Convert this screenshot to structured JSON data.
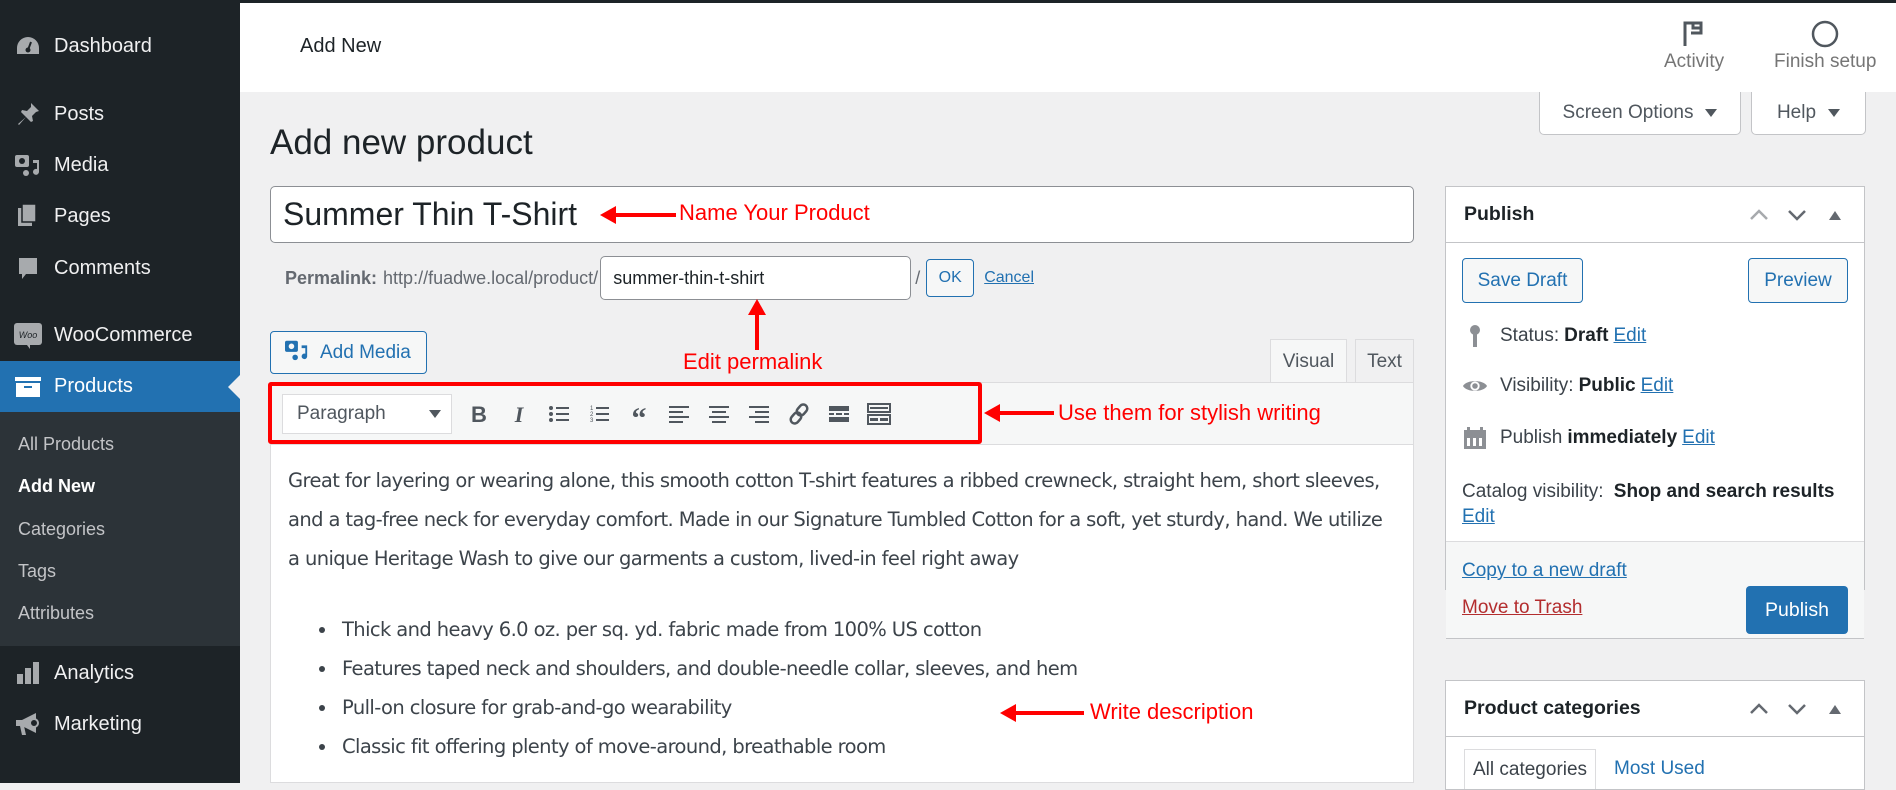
{
  "sidebar": {
    "items": [
      {
        "label": "Dashboard",
        "icon": "dashboard-icon"
      },
      {
        "label": "Posts",
        "icon": "pin-icon"
      },
      {
        "label": "Media",
        "icon": "media-icon"
      },
      {
        "label": "Pages",
        "icon": "pages-icon"
      },
      {
        "label": "Comments",
        "icon": "comment-icon"
      },
      {
        "label": "WooCommerce",
        "icon": "woo-icon"
      },
      {
        "label": "Products",
        "icon": "archive-box-icon",
        "active": true
      },
      {
        "label": "Analytics",
        "icon": "bar-chart-icon"
      },
      {
        "label": "Marketing",
        "icon": "megaphone-icon"
      }
    ],
    "submenu": [
      {
        "label": "All Products"
      },
      {
        "label": "Add New",
        "current": true
      },
      {
        "label": "Categories"
      },
      {
        "label": "Tags"
      },
      {
        "label": "Attributes"
      }
    ]
  },
  "header": {
    "title": "Add New",
    "activity_label": "Activity",
    "finish_setup_label": "Finish setup"
  },
  "screen_options_label": "Screen Options",
  "help_label": "Help",
  "page_title": "Add new product",
  "product": {
    "title": "Summer Thin T-Shirt",
    "permalink_label": "Permalink:",
    "permalink_base": "http://fuadwe.local/product/",
    "slug": "summer-thin-t-shirt",
    "slug_suffix": "/",
    "ok_label": "OK",
    "cancel_label": "Cancel"
  },
  "editor": {
    "add_media_label": "Add Media",
    "tabs": [
      {
        "label": "Visual",
        "active": true
      },
      {
        "label": "Text"
      }
    ],
    "format_select": "Paragraph",
    "toolbar": [
      "bold",
      "italic",
      "bullet-list",
      "numbered-list",
      "blockquote",
      "align-left",
      "align-center",
      "align-right",
      "link",
      "read-more",
      "toolbar-toggle"
    ],
    "paragraph": "Great for layering or wearing alone, this smooth cotton T-shirt features a ribbed crewneck, straight hem, short sleeves, and a tag-free neck for everyday comfort. Made in our Signature Tumbled Cotton for a soft, yet sturdy, hand. We utilize a unique Heritage Wash to give our garments a custom, lived-in feel right away",
    "bullets": [
      "Thick and heavy 6.0 oz. per sq. yd. fabric made from 100% US cotton",
      "Features taped neck and shoulders, and double-needle collar, sleeves, and hem",
      "Pull-on closure for grab-and-go wearability",
      "Classic fit offering plenty of move-around, breathable room"
    ]
  },
  "annotations": {
    "name_product": "Name Your Product",
    "edit_permalink": "Edit permalink",
    "toolbar_hint": "Use them for stylish writing",
    "write_description": "Write description",
    "color": "#ff0000"
  },
  "publish": {
    "title": "Publish",
    "save_draft_label": "Save Draft",
    "preview_label": "Preview",
    "status_label": "Status:",
    "status_value": "Draft",
    "visibility_label": "Visibility:",
    "visibility_value": "Public",
    "publish_label": "Publish",
    "publish_value": "immediately",
    "catalog_label": "Catalog visibility:",
    "catalog_value": "Shop and search results",
    "edit_label": "Edit",
    "copy_draft_label": "Copy to a new draft",
    "trash_label": "Move to Trash",
    "publish_button_label": "Publish"
  },
  "categories": {
    "title": "Product categories",
    "tabs": [
      {
        "label": "All categories",
        "active": true
      },
      {
        "label": "Most Used"
      }
    ]
  },
  "colors": {
    "accent": "#2271b1",
    "sidebar_bg": "#1d2327",
    "submenu_bg": "#2c3338",
    "trash": "#b32d2e"
  }
}
